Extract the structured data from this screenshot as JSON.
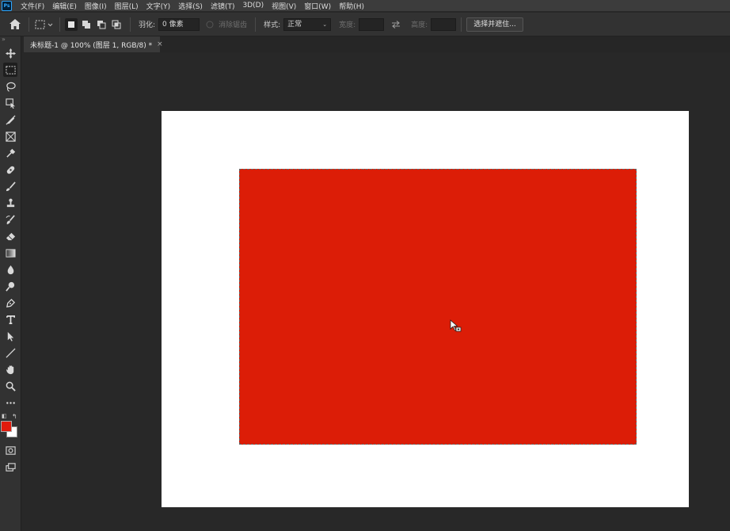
{
  "app": {
    "logo_text": "Ps"
  },
  "menu": [
    "文件(F)",
    "编辑(E)",
    "图像(I)",
    "图层(L)",
    "文字(Y)",
    "选择(S)",
    "滤镜(T)",
    "3D(D)",
    "视图(V)",
    "窗口(W)",
    "帮助(H)"
  ],
  "options": {
    "feather_label": "羽化:",
    "feather_value": "0 像素",
    "antialias_label": "消除锯齿",
    "style_label": "样式:",
    "style_value": "正常",
    "width_label": "宽度:",
    "height_label": "高度:",
    "select_mask_button": "选择并遮住..."
  },
  "document_tab": {
    "title": "未标题-1 @ 100% (图层 1, RGB/8) *",
    "close": "×"
  },
  "colors": {
    "foreground": "#e01b0d",
    "background": "#ffffff",
    "fill": "#dc1d07"
  },
  "tools": [
    "move-tool",
    "marquee-tool",
    "lasso-tool",
    "object-select-tool",
    "crop-tool",
    "frame-tool",
    "eyedropper-tool",
    "healing-brush-tool",
    "brush-tool",
    "stamp-tool",
    "history-brush-tool",
    "eraser-tool",
    "gradient-tool",
    "blur-tool",
    "dodge-tool",
    "pen-tool",
    "type-tool",
    "path-select-tool",
    "line-tool",
    "hand-tool",
    "zoom-tool",
    "more-tools"
  ]
}
